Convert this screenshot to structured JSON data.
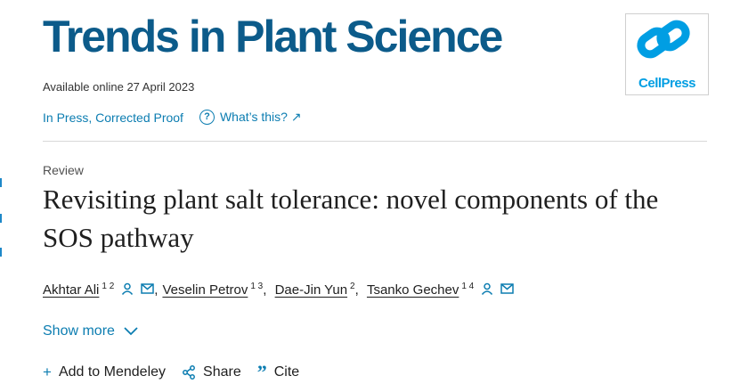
{
  "journal": {
    "title": "Trends in Plant Science",
    "available": "Available online 27 April 2023",
    "status": "In Press, Corrected Proof",
    "whats_this": "What’s this? ↗",
    "logo_text": "CellPress",
    "brand_color": "#0c5b8a",
    "logo_color": "#009ee3"
  },
  "article": {
    "type": "Review",
    "title": "Revisiting plant salt tolerance: novel components of the SOS pathway"
  },
  "authors": [
    {
      "name": "Akhtar Ali",
      "sup": "1 2",
      "icons": [
        "person-icon",
        "mail-icon"
      ]
    },
    {
      "name": "Veselin Petrov",
      "sup": "1 3",
      "icons": []
    },
    {
      "name": "Dae-Jin Yun",
      "sup": "2",
      "icons": []
    },
    {
      "name": "Tsanko Gechev",
      "sup": "1 4",
      "icons": [
        "person-icon",
        "mail-icon"
      ]
    }
  ],
  "show_more": "Show more",
  "actions": {
    "mendeley": "Add to Mendeley",
    "share": "Share",
    "cite": "Cite"
  },
  "link_color": "#0c7db1"
}
